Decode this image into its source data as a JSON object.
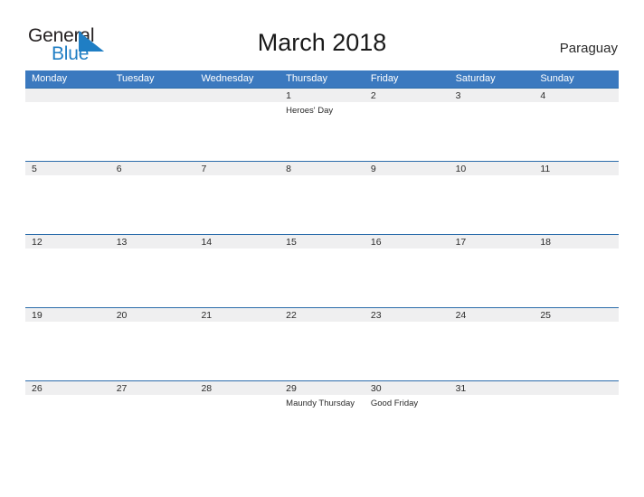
{
  "brand": {
    "name_part1": "General",
    "name_part2": "Blue",
    "mark_icon": "triangle-flag-icon",
    "color_dark": "#231f20",
    "color_blue": "#1f7ec4"
  },
  "header": {
    "title": "March 2018",
    "country": "Paraguay"
  },
  "theme": {
    "header_blue": "#3b79bf",
    "row_border_blue": "#2b6cab",
    "band_gray": "#efeff0",
    "text": "#2a2a2a",
    "background": "#ffffff"
  },
  "calendar": {
    "weekday_headers": [
      "Monday",
      "Tuesday",
      "Wednesday",
      "Thursday",
      "Friday",
      "Saturday",
      "Sunday"
    ],
    "weeks": [
      [
        {
          "date": "",
          "event": ""
        },
        {
          "date": "",
          "event": ""
        },
        {
          "date": "",
          "event": ""
        },
        {
          "date": "1",
          "event": "Heroes' Day"
        },
        {
          "date": "2",
          "event": ""
        },
        {
          "date": "3",
          "event": ""
        },
        {
          "date": "4",
          "event": ""
        }
      ],
      [
        {
          "date": "5",
          "event": ""
        },
        {
          "date": "6",
          "event": ""
        },
        {
          "date": "7",
          "event": ""
        },
        {
          "date": "8",
          "event": ""
        },
        {
          "date": "9",
          "event": ""
        },
        {
          "date": "10",
          "event": ""
        },
        {
          "date": "11",
          "event": ""
        }
      ],
      [
        {
          "date": "12",
          "event": ""
        },
        {
          "date": "13",
          "event": ""
        },
        {
          "date": "14",
          "event": ""
        },
        {
          "date": "15",
          "event": ""
        },
        {
          "date": "16",
          "event": ""
        },
        {
          "date": "17",
          "event": ""
        },
        {
          "date": "18",
          "event": ""
        }
      ],
      [
        {
          "date": "19",
          "event": ""
        },
        {
          "date": "20",
          "event": ""
        },
        {
          "date": "21",
          "event": ""
        },
        {
          "date": "22",
          "event": ""
        },
        {
          "date": "23",
          "event": ""
        },
        {
          "date": "24",
          "event": ""
        },
        {
          "date": "25",
          "event": ""
        }
      ],
      [
        {
          "date": "26",
          "event": ""
        },
        {
          "date": "27",
          "event": ""
        },
        {
          "date": "28",
          "event": ""
        },
        {
          "date": "29",
          "event": "Maundy Thursday"
        },
        {
          "date": "30",
          "event": "Good Friday"
        },
        {
          "date": "31",
          "event": ""
        },
        {
          "date": "",
          "event": ""
        }
      ]
    ]
  }
}
